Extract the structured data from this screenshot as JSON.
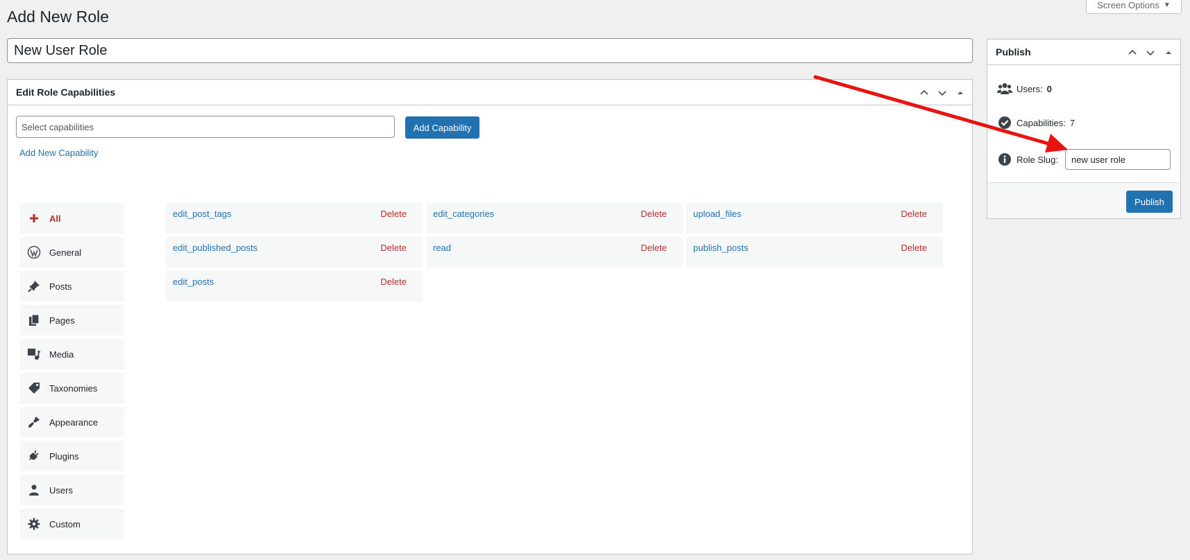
{
  "page": {
    "title": "Add New Role"
  },
  "screen_options": {
    "label": "Screen Options"
  },
  "role_title": {
    "value": "New User Role"
  },
  "capabilities_box": {
    "title": "Edit Role Capabilities",
    "select_placeholder": "Select capabilities",
    "add_button": "Add Capability",
    "add_new_link": "Add New Capability",
    "categories": [
      {
        "label": "All",
        "icon": "plus-icon",
        "active": true
      },
      {
        "label": "General",
        "icon": "wordpress-icon"
      },
      {
        "label": "Posts",
        "icon": "pushpin-icon"
      },
      {
        "label": "Pages",
        "icon": "pages-icon"
      },
      {
        "label": "Media",
        "icon": "media-icon"
      },
      {
        "label": "Taxonomies",
        "icon": "tag-icon"
      },
      {
        "label": "Appearance",
        "icon": "brush-icon"
      },
      {
        "label": "Plugins",
        "icon": "plugin-icon"
      },
      {
        "label": "Users",
        "icon": "user-icon"
      },
      {
        "label": "Custom",
        "icon": "gear-icon"
      }
    ],
    "capabilities": [
      {
        "name": "edit_post_tags",
        "action": "Delete"
      },
      {
        "name": "edit_categories",
        "action": "Delete"
      },
      {
        "name": "upload_files",
        "action": "Delete"
      },
      {
        "name": "edit_published_posts",
        "action": "Delete"
      },
      {
        "name": "read",
        "action": "Delete"
      },
      {
        "name": "publish_posts",
        "action": "Delete"
      },
      {
        "name": "edit_posts",
        "action": "Delete"
      }
    ]
  },
  "publish_box": {
    "title": "Publish",
    "users_label": "Users:",
    "users_count": "0",
    "capabilities_label": "Capabilities:",
    "capabilities_count": "7",
    "slug_label": "Role Slug:",
    "slug_value": "new user role",
    "publish_button": "Publish"
  },
  "colors": {
    "accent": "#2271b1",
    "danger": "#b32d2e",
    "annotation": "#e8130e"
  }
}
